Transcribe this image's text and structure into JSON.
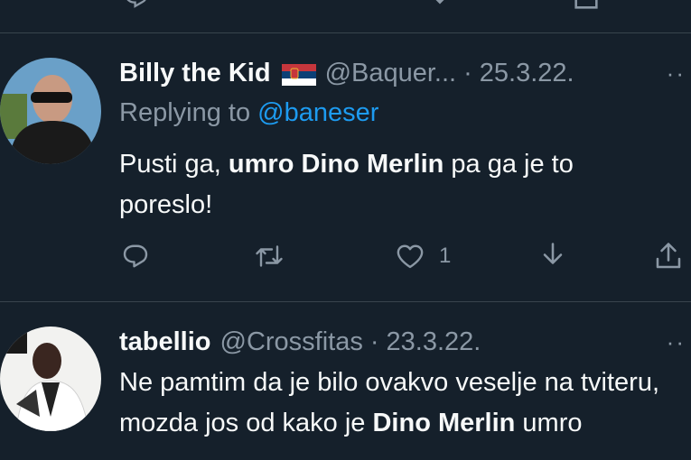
{
  "tweets": [
    {
      "name": "Billy the Kid",
      "flag": "serbian-flag",
      "handle": "@Baquer...",
      "dot": "·",
      "date": "25.3.22.",
      "more": "··",
      "replying_prefix": "Replying to",
      "replying_handle": "@baneser",
      "text_before": "Pusti ga, ",
      "text_bold": "umro Dino Merlin",
      "text_after": " pa ga je to poreslo!",
      "like_count": "1"
    },
    {
      "name": "tabellio",
      "handle": "@Crossfitas",
      "dot": "·",
      "date": "23.3.22.",
      "more": "··",
      "text_before": "Ne pamtim da je bilo ovakvo veselje na tviteru, mozda jos od kako je ",
      "text_bold": "Dino Merlin",
      "text_after": " umro"
    }
  ],
  "icons": {
    "reply": "reply-icon",
    "retweet": "retweet-icon",
    "like": "heart-icon",
    "download": "download-icon",
    "share": "share-icon"
  },
  "colors": {
    "background": "#15202b",
    "divider": "#38444d",
    "text": "#f7f9f9",
    "secondary": "#8b98a5",
    "link": "#1d9bf0"
  }
}
